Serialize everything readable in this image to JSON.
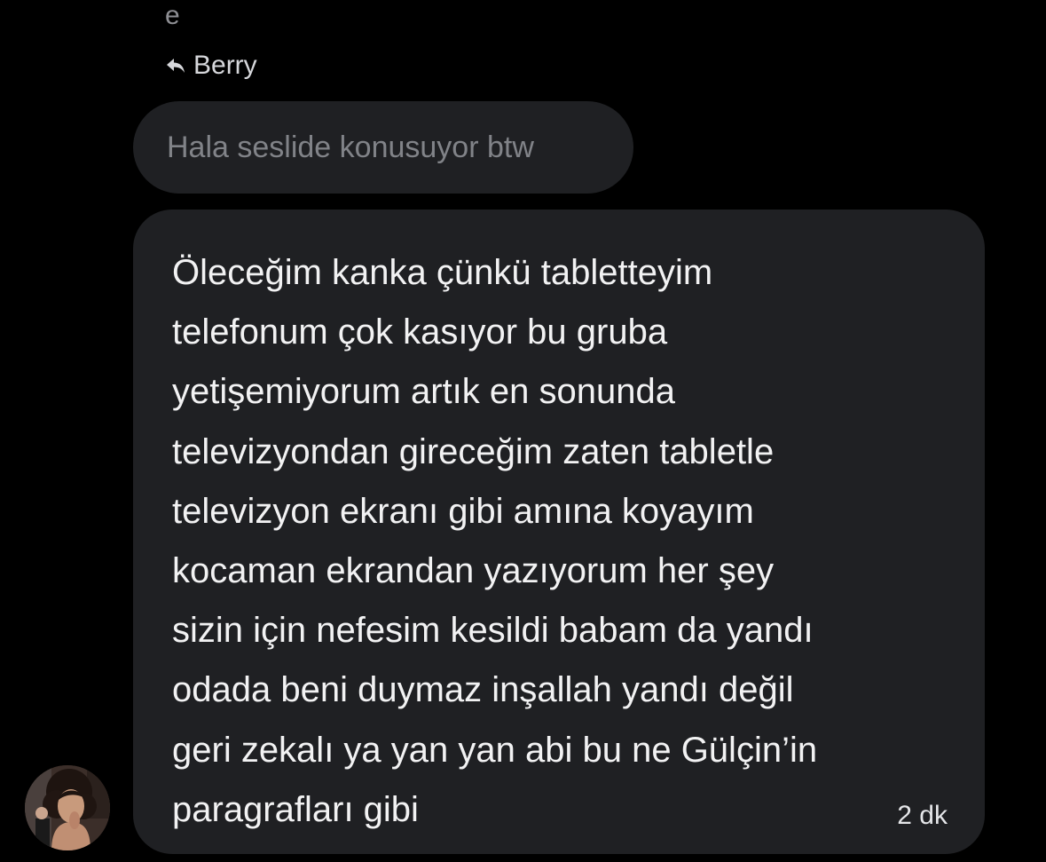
{
  "previous_fragment": "e",
  "reply": {
    "icon": "reply-arrow-icon",
    "to": "Berry"
  },
  "quoted_message": "Hala seslide konusuyor btw",
  "message": {
    "lines": [
      "Öleceğim kanka çünkü tabletteyim",
      "telefonum çok kasıyor bu gruba",
      "yetişemiyorum artık en sonunda",
      "televizyondan gireceğim zaten tabletle",
      "televizyon ekranı gibi amına koyayım",
      "kocaman ekrandan yazıyorum her şey",
      "sizin için nefesim kesildi babam da yandı",
      "odada beni duymaz inşallah yandı değil",
      "geri zekalı ya yan yan abi bu ne Gülçin’in",
      "paragrafları gibi"
    ],
    "timestamp": "2 dk"
  },
  "colors": {
    "background": "#000000",
    "bubble": "#1f2023",
    "text": "#f2f2f3",
    "muted": "#818388"
  }
}
